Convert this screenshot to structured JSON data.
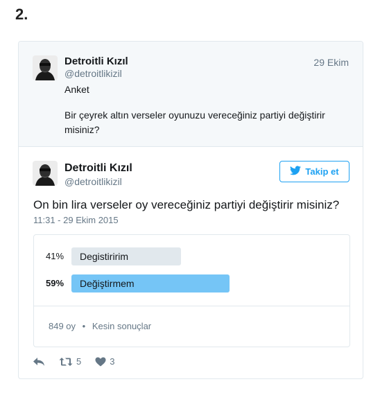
{
  "heading": "2.",
  "quoted": {
    "name": "Detroitli Kızıl",
    "handle": "@detroitlikizil",
    "date": "29 Ekim",
    "line1": "Anket",
    "line2": "Bir çeyrek altın verseler oyunuzu vereceğiniz partiyi değiştirir",
    "line3": "misiniz?"
  },
  "tweet": {
    "name": "Detroitli Kızıl",
    "handle": "@detroitlikizil",
    "follow_label": "Takip et",
    "text": "On bin lira verseler oy vereceğiniz partiyi değiştirir misiniz?",
    "timestamp": "11:31 - 29 Ekim 2015"
  },
  "poll": {
    "options": [
      {
        "pct_label": "41%",
        "label": "Degistiririm",
        "value": 41,
        "color": "#e1e8ed",
        "winner": false
      },
      {
        "pct_label": "59%",
        "label": "Değiştirmem",
        "value": 59,
        "color": "#75c5f6",
        "winner": true
      }
    ],
    "votes": "849 oy",
    "separator": "•",
    "status": "Kesin sonuçlar"
  },
  "actions": {
    "retweets": "5",
    "likes": "3"
  },
  "colors": {
    "accent": "#1da1f2",
    "muted": "#657786",
    "border": "#e1e8ed"
  }
}
